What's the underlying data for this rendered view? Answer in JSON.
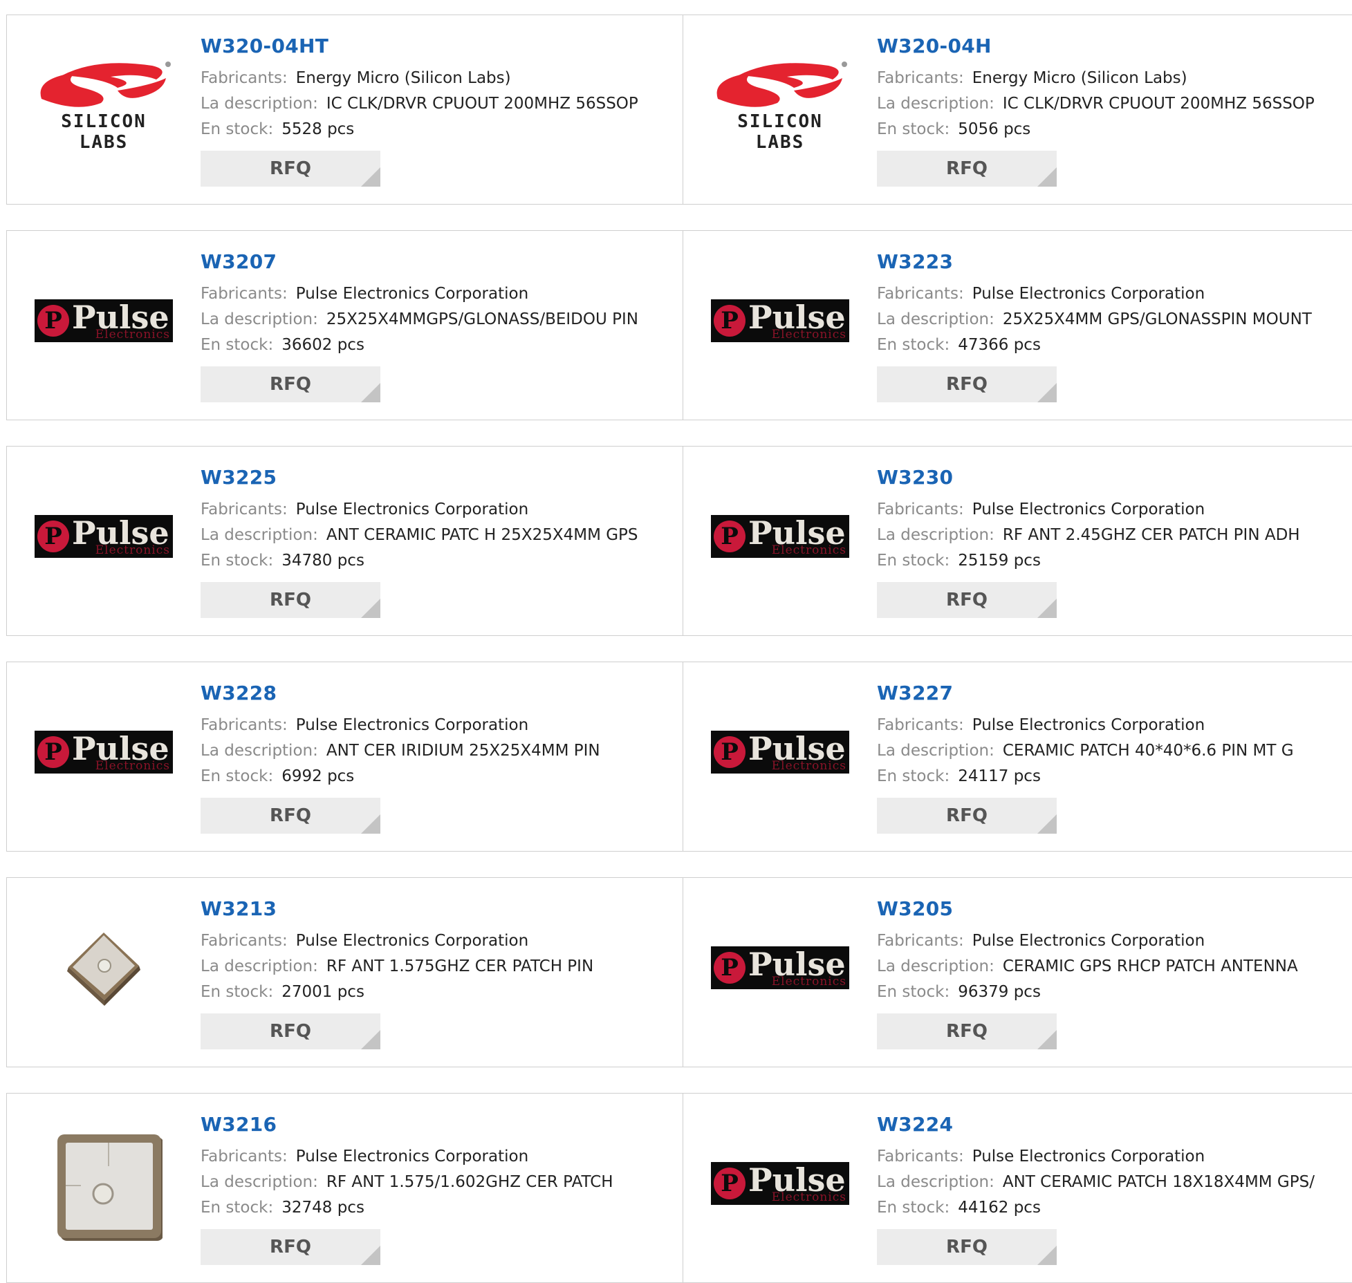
{
  "labels": {
    "manufacturer": "Fabricants:",
    "description": "La description:",
    "stock": "En stock:",
    "rfq": "RFQ"
  },
  "logos": {
    "silicon_labs_text": "SILICON LABS",
    "pulse_word": "Pulse",
    "pulse_sub": "Electronics"
  },
  "colors": {
    "part_link": "#1a64b4",
    "silicon_labs_red": "#e4232f",
    "pulse_red": "#c9193a"
  },
  "products": [
    {
      "part": "W320-04HT",
      "manufacturer": "Energy Micro (Silicon Labs)",
      "description": "IC CLK/DRVR CPUOUT 200MHZ 56SSOP",
      "stock": "5528 pcs",
      "logo": "silicon-labs"
    },
    {
      "part": "W320-04H",
      "manufacturer": "Energy Micro (Silicon Labs)",
      "description": "IC CLK/DRVR CPUOUT 200MHZ 56SSOP",
      "stock": "5056 pcs",
      "logo": "silicon-labs"
    },
    {
      "part": "W3207",
      "manufacturer": "Pulse Electronics Corporation",
      "description": "25X25X4MMGPS/GLONASS/BEIDOU PIN",
      "stock": "36602 pcs",
      "logo": "pulse"
    },
    {
      "part": "W3223",
      "manufacturer": "Pulse Electronics Corporation",
      "description": "25X25X4MM GPS/GLONASSPIN MOUNT",
      "stock": "47366 pcs",
      "logo": "pulse"
    },
    {
      "part": "W3225",
      "manufacturer": "Pulse Electronics Corporation",
      "description": "ANT CERAMIC PATC H 25X25X4MM GPS",
      "stock": "34780 pcs",
      "logo": "pulse"
    },
    {
      "part": "W3230",
      "manufacturer": "Pulse Electronics Corporation",
      "description": "RF ANT 2.45GHZ CER PATCH PIN ADH",
      "stock": "25159 pcs",
      "logo": "pulse"
    },
    {
      "part": "W3228",
      "manufacturer": "Pulse Electronics Corporation",
      "description": "ANT CER IRIDIUM 25X25X4MM PIN",
      "stock": "6992 pcs",
      "logo": "pulse"
    },
    {
      "part": "W3227",
      "manufacturer": "Pulse Electronics Corporation",
      "description": "CERAMIC PATCH 40*40*6.6 PIN MT G",
      "stock": "24117 pcs",
      "logo": "pulse"
    },
    {
      "part": "W3213",
      "manufacturer": "Pulse Electronics Corporation",
      "description": "RF ANT 1.575GHZ CER PATCH PIN",
      "stock": "27001 pcs",
      "logo": "antenna-small"
    },
    {
      "part": "W3205",
      "manufacturer": "Pulse Electronics Corporation",
      "description": "CERAMIC GPS RHCP PATCH ANTENNA",
      "stock": "96379 pcs",
      "logo": "pulse"
    },
    {
      "part": "W3216",
      "manufacturer": "Pulse Electronics Corporation",
      "description": "RF ANT 1.575/1.602GHZ CER PATCH",
      "stock": "32748 pcs",
      "logo": "antenna-large"
    },
    {
      "part": "W3224",
      "manufacturer": "Pulse Electronics Corporation",
      "description": "ANT CERAMIC PATCH 18X18X4MM GPS/",
      "stock": "44162 pcs",
      "logo": "pulse"
    }
  ]
}
